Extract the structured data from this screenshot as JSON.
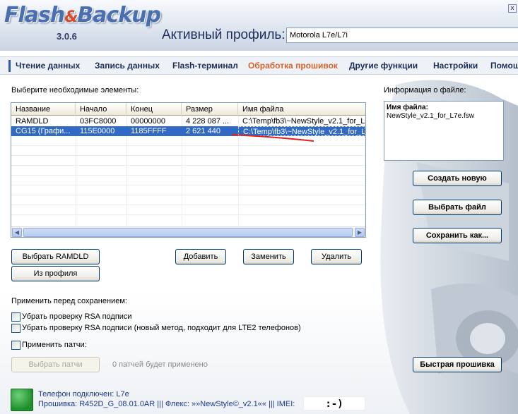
{
  "app": {
    "logo_text_1": "Flash",
    "logo_amp": "&",
    "logo_text_2": "Backup",
    "version": "3.0.6",
    "close_symbol": "x"
  },
  "profile": {
    "label": "Активный профиль:",
    "value": "Motorola L7e/L7i"
  },
  "nav": {
    "tabs": [
      {
        "label": "Чтение данных",
        "active": false
      },
      {
        "label": "Запись данных",
        "active": false
      },
      {
        "label": "Flash-терминал",
        "active": false
      },
      {
        "label": "Обработка прошивок",
        "active": true
      },
      {
        "label": "Другие функции",
        "active": false
      },
      {
        "label": "Настройки",
        "active": false
      },
      {
        "label": "Помощь",
        "active": false
      }
    ]
  },
  "elements": {
    "prompt": "Выберите необходимые элементы:",
    "columns": [
      "Название",
      "Начало",
      "Конец",
      "Размер",
      "Имя файла"
    ],
    "rows": [
      {
        "name": "RAMDLD",
        "start": "03FC8000",
        "end": "00000000",
        "size": "4 228 087 ...",
        "file": "C:\\Temp\\fb3\\~NewStyle_v2.1_for_L",
        "selected": false
      },
      {
        "name": "CG15 (Графи...",
        "start": "115E0000",
        "end": "1185FFFF",
        "size": "2 621 440",
        "file": "C:\\Temp\\fb3\\~NewStyle_v2.1_for_L",
        "selected": true
      }
    ]
  },
  "buttons": {
    "select_ramdld": "Выбрать RAMDLD",
    "from_profile": "Из профиля",
    "add": "Добавить",
    "replace": "Заменить",
    "delete": "Удалить",
    "create_new": "Создать новую",
    "select_file": "Выбрать файл",
    "save_as": "Сохранить как...",
    "quick_flash": "Быстрая прошивка",
    "select_patches": "Выбрать патчи"
  },
  "info": {
    "title": "Информация о файле:",
    "file_label": "Имя файла:",
    "file_value": "NewStyle_v2.1_for_L7e.fsw"
  },
  "apply": {
    "heading": "Применить перед сохранением:",
    "rsa_remove": "Убрать проверку RSA подписи",
    "rsa_remove_new": "Убрать проверку RSA подписи (новый метод, подходит для LTE2 телефонов)",
    "apply_patches": "Применить патчи:",
    "patches_count": "0 патчей будет применено"
  },
  "status": {
    "line1": "Телефон подключен:  L7e",
    "line2": "Прошивка: R452D_G_08.01.0AR ||| Флекс: »»NewStyle©_v2.1«« ||| IMEI:",
    "imei": ":-)"
  },
  "colors": {
    "accent": "#d9632b",
    "nav_text": "#1c2d5c",
    "selection": "#316ac5",
    "annotation": "#e0201a",
    "status_text": "#1c3a8c"
  }
}
